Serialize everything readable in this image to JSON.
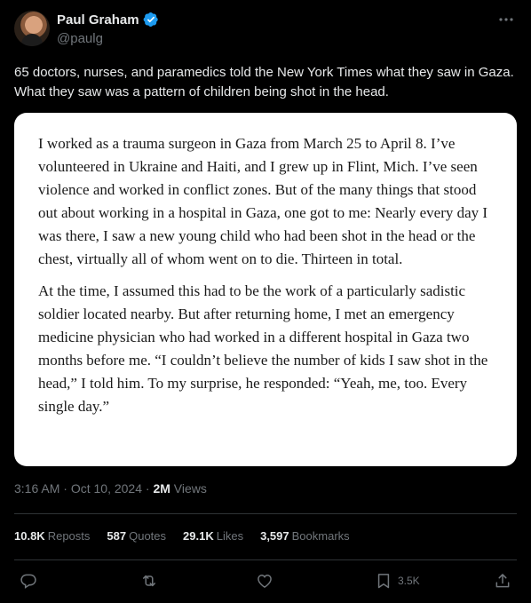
{
  "author": {
    "name": "Paul Graham",
    "handle": "@paulg",
    "verified_icon": "verified-badge-icon"
  },
  "tweet": {
    "text": "65 doctors, nurses, and paramedics told the New York Times what they saw in Gaza. What they saw was a pattern of children being shot in the head."
  },
  "quote": {
    "paragraphs": [
      "I worked as a trauma surgeon in Gaza from March 25 to April 8. I’ve volunteered in Ukraine and Haiti, and I grew up in Flint, Mich. I’ve seen violence and worked in conflict zones. But of the many things that stood out about working in a hospital in Gaza, one got to me: Nearly every day I was there, I saw a new young child who had been shot in the head or the chest, virtually all of whom went on to die. Thirteen in total.",
      "At the time, I assumed this had to be the work of a particularly sadistic soldier located nearby. But after returning home, I met an emergency medicine physician who had worked in a different hospital in Gaza two months before me. “I couldn’t believe the number of kids I saw shot in the head,” I told him. To my surprise, he responded: “Yeah, me, too. Every single day.”"
    ]
  },
  "meta": {
    "time": "3:16 AM",
    "separator": " · ",
    "date": "Oct 10, 2024",
    "views_count": "2M",
    "views_label": "Views"
  },
  "stats": [
    {
      "count": "10.8K",
      "label": "Reposts"
    },
    {
      "count": "587",
      "label": "Quotes"
    },
    {
      "count": "29.1K",
      "label": "Likes"
    },
    {
      "count": "3,597",
      "label": "Bookmarks"
    }
  ],
  "actions": {
    "reply_icon": "reply-icon",
    "repost_icon": "repost-icon",
    "like_icon": "heart-icon",
    "bookmark_icon": "bookmark-icon",
    "bookmark_count": "3.5K",
    "share_icon": "share-icon",
    "more_icon": "more-icon"
  },
  "colors": {
    "background": "#000000",
    "text_primary": "#e7e9ea",
    "text_secondary": "#71767b",
    "verified": "#1d9bf0",
    "divider": "#2f3336",
    "card": "#ffffff"
  }
}
